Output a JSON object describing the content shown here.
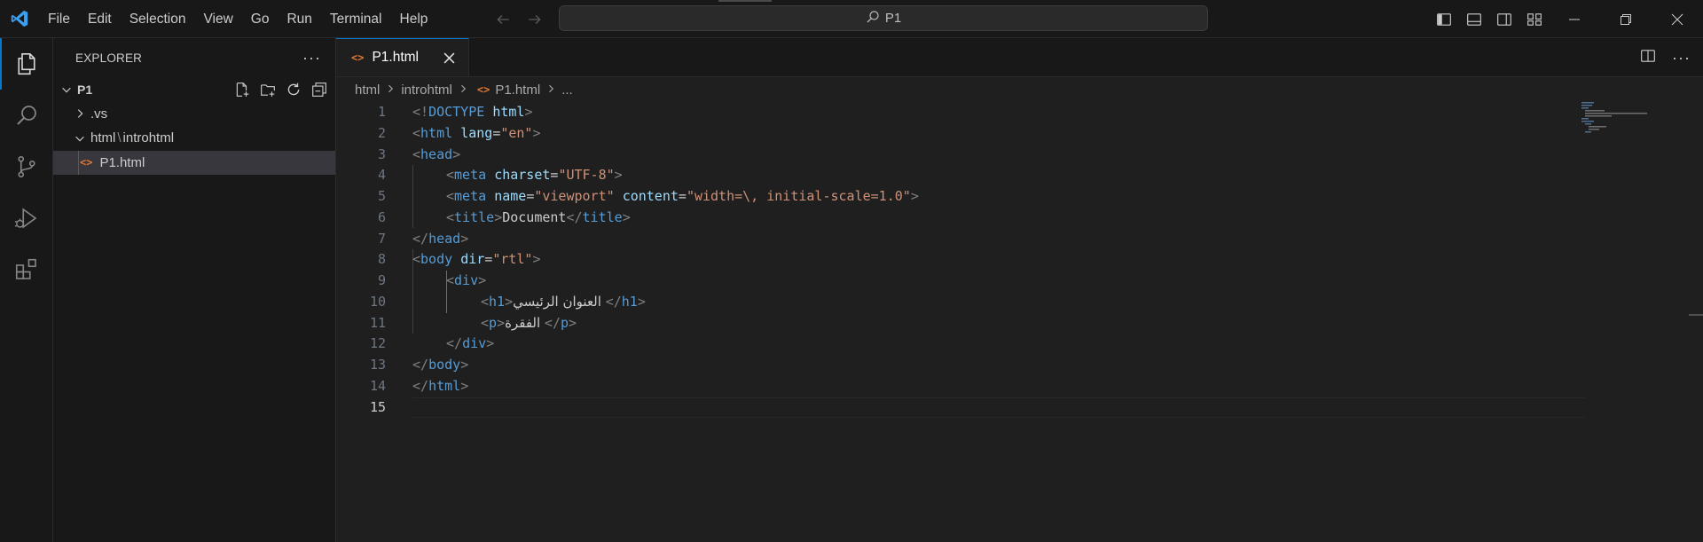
{
  "titlebar": {
    "menu": [
      "File",
      "Edit",
      "Selection",
      "View",
      "Go",
      "Run",
      "Terminal",
      "Help"
    ],
    "search_text": "P1"
  },
  "sidebar": {
    "title": "EXPLORER",
    "more": "···",
    "root": "P1",
    "items": [
      {
        "label": ".vs"
      },
      {
        "label_a": "html",
        "sep": "\\",
        "label_b": "introhtml"
      },
      {
        "label": "P1.html"
      }
    ]
  },
  "editor": {
    "tab_label": "P1.html",
    "breadcrumbs": [
      "html",
      "introhtml",
      "P1.html",
      "..."
    ],
    "line_numbers": [
      "1",
      "2",
      "3",
      "4",
      "5",
      "6",
      "7",
      "8",
      "9",
      "10",
      "11",
      "12",
      "13",
      "14",
      "15"
    ],
    "code": {
      "l1": {
        "open": "<!",
        "doctype": "DOCTYPE",
        "space": " ",
        "html": "html",
        "close": ">"
      },
      "l2": {
        "open": "<",
        "tag": "html",
        "sp": " ",
        "attr": "lang",
        "eq": "=",
        "val": "\"en\"",
        "close": ">"
      },
      "l3": {
        "open": "<",
        "tag": "head",
        "close": ">"
      },
      "l4": {
        "open": "<",
        "tag": "meta",
        "sp": " ",
        "attr": "charset",
        "eq": "=",
        "val": "\"UTF-8\"",
        "close": ">"
      },
      "l5": {
        "open": "<",
        "tag": "meta",
        "sp": " ",
        "attr1": "name",
        "eq1": "=",
        "val1": "\"viewport\"",
        "sp2": " ",
        "attr2": "content",
        "eq2": "=",
        "val2": "\"width=\\, initial-scale=1.0\"",
        "close": ">"
      },
      "l6": {
        "open": "<",
        "tag": "title",
        "close": ">",
        "text": "Document",
        "open2": "</",
        "tag2": "title",
        "close2": ">"
      },
      "l7": {
        "open": "</",
        "tag": "head",
        "close": ">"
      },
      "l8": {
        "open": "<",
        "tag": "body",
        "sp": " ",
        "attr": "dir",
        "eq": "=",
        "val": "\"rtl\"",
        "close": ">"
      },
      "l9": {
        "open": "<",
        "tag": "div",
        "close": ">"
      },
      "l10": {
        "open": "<",
        "tag": "h1",
        "close": ">",
        "text": " العنوان الرئيسي",
        "open2": "</",
        "tag2": "h1",
        "close2": ">"
      },
      "l11": {
        "open": "<",
        "tag": "p",
        "close": ">",
        "text": " الفقرة",
        "open2": "</",
        "tag2": "p",
        "close2": ">"
      },
      "l12": {
        "open": "</",
        "tag": "div",
        "close": ">"
      },
      "l13": {
        "open": "</",
        "tag": "body",
        "close": ">"
      },
      "l14": {
        "open": "</",
        "tag": "html",
        "close": ">"
      }
    }
  },
  "colors": {
    "accent": "#0078d4",
    "html_file_icon": "#e37933",
    "tag": "#569cd6",
    "attribute": "#9cdcfe",
    "string": "#ce9178",
    "punctuation": "#808080"
  }
}
